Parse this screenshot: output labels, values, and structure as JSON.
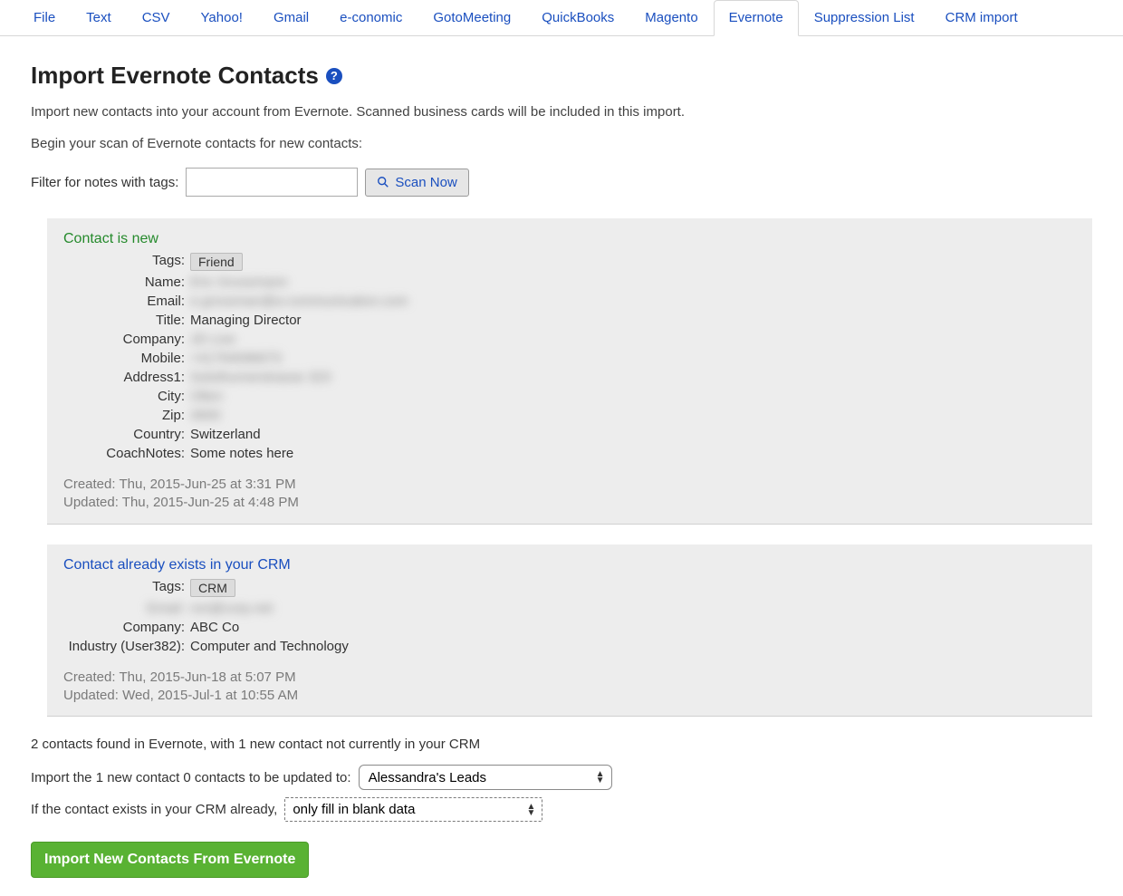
{
  "tabs": {
    "items": [
      "File",
      "Text",
      "CSV",
      "Yahoo!",
      "Gmail",
      "e-conomic",
      "GotoMeeting",
      "QuickBooks",
      "Magento",
      "Evernote",
      "Suppression List",
      "CRM import"
    ],
    "active_index": 9
  },
  "page": {
    "title": "Import Evernote Contacts",
    "description": "Import new contacts into your account from Evernote. Scanned business cards will be included in this import.",
    "begin_scan_text": "Begin your scan of Evernote contacts for new contacts:",
    "filter_label": "Filter for notes with tags:",
    "filter_value": "",
    "scan_button": "Scan Now"
  },
  "contact_new": {
    "status": "Contact is new",
    "labels": {
      "tags": "Tags:",
      "name": "Name:",
      "email": "Email:",
      "title": "Title:",
      "company": "Company:",
      "mobile": "Mobile:",
      "address1": "Address1:",
      "city": "City:",
      "zip": "Zip:",
      "country": "Country:",
      "coachnotes": "CoachNotes:"
    },
    "tag": "Friend",
    "name": "Eric Grossmann",
    "email": "e.grossman@a-communication.com",
    "title": "Managing Director",
    "company": "JD Live",
    "mobile": "+41794096673",
    "address1": "Solothurnerstrasse 323",
    "city": "Olten",
    "zip": "4600",
    "country": "Switzerland",
    "coachnotes": "Some notes here",
    "created_label": "Created:",
    "created": "Thu, 2015-Jun-25 at 3:31 PM",
    "updated_label": "Updated:",
    "updated": "Thu, 2015-Jun-25 at 4:48 PM"
  },
  "contact_existing": {
    "status": "Contact already exists in your CRM",
    "labels": {
      "tags": "Tags:",
      "email": "Email:",
      "company": "Company:",
      "industry": "Industry (User382):"
    },
    "tag": "CRM",
    "email": "ron@corp.net",
    "company": "ABC Co",
    "industry": "Computer and Technology",
    "created_label": "Created:",
    "created": "Thu, 2015-Jun-18 at 5:07 PM",
    "updated_label": "Updated:",
    "updated": "Wed, 2015-Jul-1 at 10:55 AM"
  },
  "summary": {
    "found_text": "2 contacts found in Evernote, with 1 new contact not currently in your CRM",
    "import_to_label": "Import the 1 new contact 0 contacts to be updated to:",
    "import_to_value": "Alessandra's Leads",
    "exists_label": "If the contact exists in your CRM already,",
    "exists_value": "only fill in blank data",
    "import_button": "Import New Contacts From Evernote"
  }
}
